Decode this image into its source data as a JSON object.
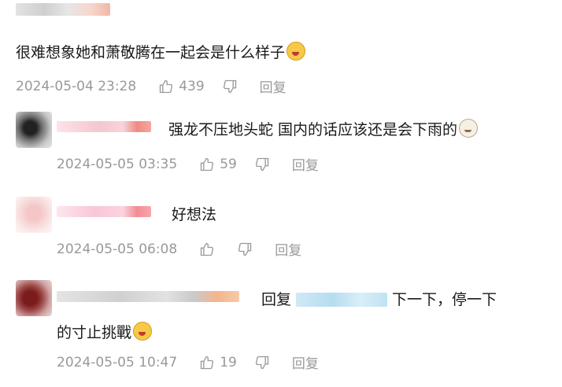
{
  "comments": [
    {
      "text": "很难想象她和萧敬腾在一起会是什么样子",
      "emoji": "crying-laughing-face",
      "time": "2024-05-04 23:28",
      "likes": "439",
      "reply_label": "回复"
    },
    {
      "text": "强龙不压地头蛇 国内的话应该还是会下雨的",
      "emoji": "cat-face",
      "time": "2024-05-05 03:35",
      "likes": "59",
      "reply_label": "回复"
    },
    {
      "text": "好想法",
      "time": "2024-05-05 06:08",
      "likes": "",
      "reply_label": "回复"
    },
    {
      "reply_prefix": "回复",
      "text_part1": "下一下，停一下",
      "text_part2": "的寸止挑戰",
      "emoji": "crying-laughing-face",
      "time": "2024-05-05 10:47",
      "likes": "19",
      "reply_label": "回复"
    }
  ],
  "colors": {
    "meta_text": "#999999",
    "main_text": "#1a1a1a"
  }
}
